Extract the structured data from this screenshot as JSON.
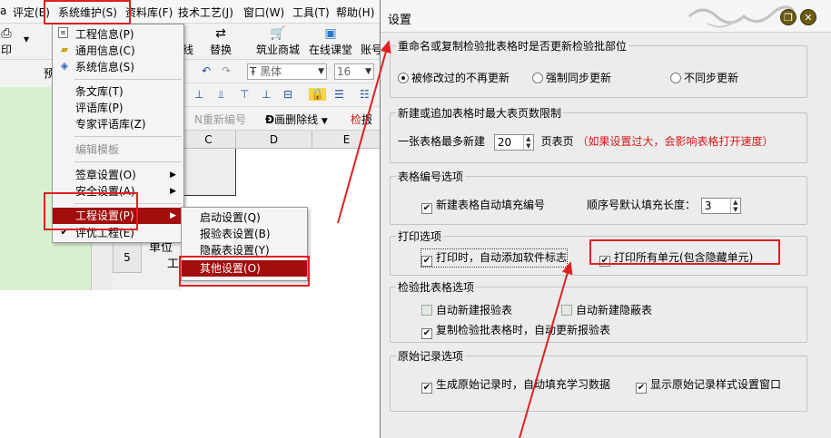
{
  "menubar": {
    "items": [
      "a",
      "评定(E)",
      "系统维护(S)",
      "资料库(F)",
      "技术工艺(J)",
      "窗口(W)",
      "工具(T)",
      "帮助(H)"
    ]
  },
  "toolbar": {
    "buttons": [
      "印",
      "预",
      "线",
      "替换",
      "筑业商城",
      "在线课堂",
      "账号"
    ],
    "font_name": "黑体",
    "font_size": "16",
    "insert_label": "重新编号",
    "line_label": "画删除线",
    "report_label": "报",
    "column_headers": [
      "C",
      "D",
      "E"
    ],
    "row_number": "5",
    "unit_cell": "单位",
    "unit_cell_2": "工"
  },
  "dropdown_menu": {
    "items": [
      {
        "label": "工程信息(P)",
        "icon": "document-icon"
      },
      {
        "label": "通用信息(C)",
        "icon": "folder-edit-icon"
      },
      {
        "label": "系统信息(S)",
        "icon": "system-info-icon"
      },
      {
        "label": "条文库(T)"
      },
      {
        "label": "评语库(P)"
      },
      {
        "label": "专家评语库(Z)"
      },
      {
        "label": "编辑模板",
        "disabled": true
      },
      {
        "label": "签章设置(O)",
        "submenu": true
      },
      {
        "label": "安全设置(A)",
        "submenu": true
      },
      {
        "label": "工程设置(P)",
        "submenu": true,
        "selected": true
      },
      {
        "label": "评优工程(E)",
        "checked": true
      }
    ]
  },
  "submenu": {
    "items": [
      {
        "label": "启动设置(Q)"
      },
      {
        "label": "报验表设置(B)"
      },
      {
        "label": "隐蔽表设置(Y)"
      },
      {
        "label": "其他设置(O)",
        "selected": true
      }
    ]
  },
  "dialog": {
    "title": "设置",
    "groups": {
      "rename": {
        "title": "重命名或复制检验批表格时是否更新检验批部位",
        "options": [
          "被修改过的不再更新",
          "强制同步更新",
          "不同步更新"
        ],
        "selected_index": 0
      },
      "pages": {
        "title": "新建或追加表格时最大表页数限制",
        "label": "一张表格最多新建",
        "value": "20",
        "unit": "页表页",
        "hint": "（如果设置过大，会影响表格打开速度）"
      },
      "numbering": {
        "title": "表格编号选项",
        "auto_fill_label": "新建表格自动填充编号",
        "auto_fill_checked": true,
        "length_label": "顺序号默认填充长度：",
        "length_value": "3"
      },
      "print": {
        "title": "打印选项",
        "add_logo_label": "打印时，自动添加软件标志",
        "add_logo_checked": true,
        "print_all_label": "打印所有单元(包含隐藏单元)",
        "print_all_checked": true
      },
      "inspection": {
        "title": "检验批表格选项",
        "auto_report_label": "自动新建报验表",
        "auto_report_checked": false,
        "auto_hidden_label": "自动新建隐蔽表",
        "auto_hidden_checked": false,
        "copy_update_label": "复制检验批表格时，自动更新报验表",
        "copy_update_checked": true
      },
      "original": {
        "title": "原始记录选项",
        "auto_learn_label": "生成原始记录时，自动填充学习数据",
        "auto_learn_checked": true,
        "show_style_label": "显示原始记录样式设置窗口",
        "show_style_checked": true
      }
    }
  },
  "colors": {
    "highlight": "#a20d0d",
    "annotation_red": "#e02020",
    "hint_red": "#d81818",
    "green_panel": "#d8f0d2"
  }
}
